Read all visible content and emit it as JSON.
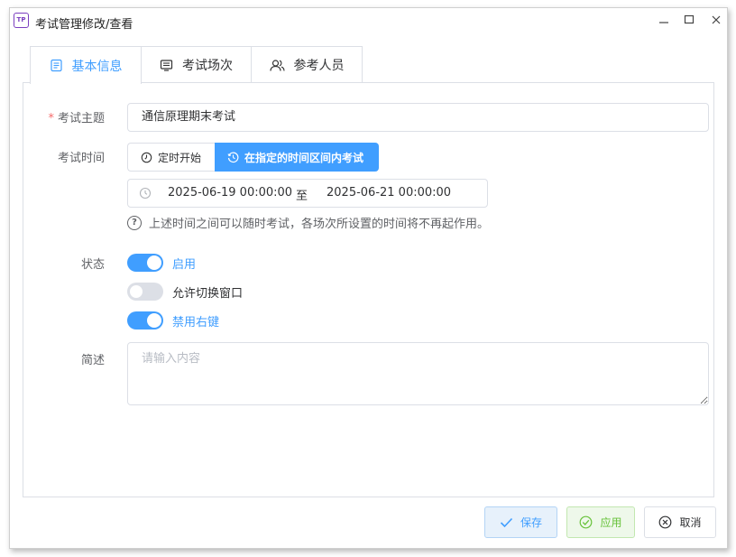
{
  "window": {
    "title": "考试管理修改/查看",
    "app_icon_text": "TP",
    "controls": {
      "minimize": "minimize",
      "maximize": "maximize",
      "close": "close"
    }
  },
  "tabs": [
    {
      "label": "基本信息",
      "icon": "document-list-icon",
      "active": true
    },
    {
      "label": "考试场次",
      "icon": "monitor-list-icon",
      "active": false
    },
    {
      "label": "参考人员",
      "icon": "users-icon",
      "active": false
    }
  ],
  "form": {
    "subject": {
      "label": "考试主题",
      "required_mark": "*",
      "value": "通信原理期末考试"
    },
    "time": {
      "label": "考试时间",
      "options": [
        {
          "label": "定时开始",
          "selected": false,
          "icon": "timer-icon"
        },
        {
          "label": "在指定的时间区间内考试",
          "selected": true,
          "icon": "clock-history-icon"
        }
      ],
      "range": {
        "start": "2025-06-19 00:00:00",
        "separator": "至",
        "end": "2025-06-21 00:00:00"
      },
      "hint": "上述时间之间可以随时考试，各场次所设置的时间将不再起作用。",
      "hint_icon": "question-circle-icon"
    },
    "status": {
      "label": "状态",
      "switches": [
        {
          "label": "启用",
          "on": true
        },
        {
          "label": "允许切换窗口",
          "on": false
        },
        {
          "label": "禁用右键",
          "on": true
        }
      ]
    },
    "description": {
      "label": "简述",
      "placeholder": "请输入内容",
      "value": ""
    }
  },
  "footer": {
    "save": {
      "label": "保存",
      "icon": "check-icon",
      "color": "#409eff"
    },
    "apply": {
      "label": "应用",
      "icon": "check-circle-icon",
      "color": "#67c23a"
    },
    "cancel": {
      "label": "取消",
      "icon": "close-circle-icon",
      "color": "#303133"
    }
  },
  "colors": {
    "primary": "#409eff",
    "success": "#67c23a",
    "danger": "#f56c6c",
    "border": "#dcdfe6"
  }
}
